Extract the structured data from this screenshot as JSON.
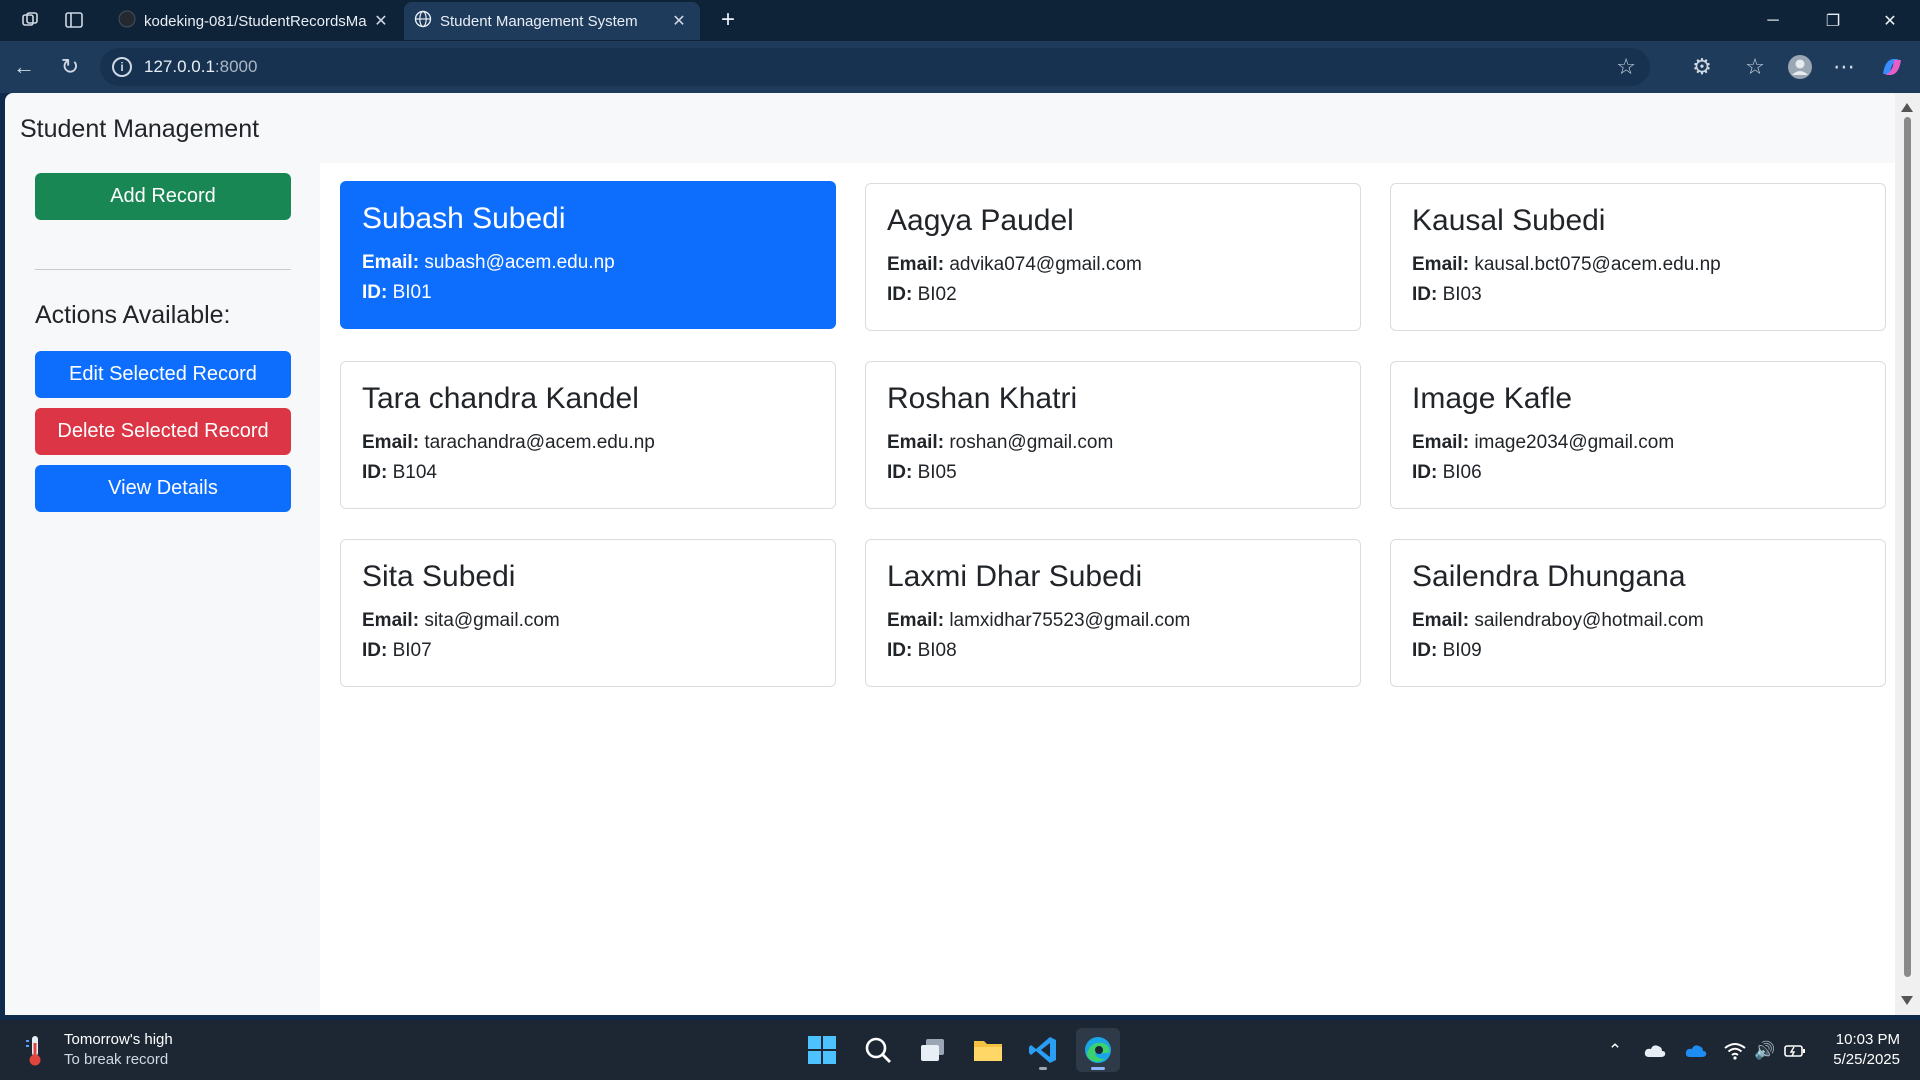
{
  "browser": {
    "tabs": [
      {
        "title": "kodeking-081/StudentRecordsMa",
        "active": false
      },
      {
        "title": "Student Management System",
        "active": true
      }
    ],
    "url_host": "127.0.0.1",
    "url_port": ":8000"
  },
  "page": {
    "brand": "Student Management",
    "sidebar": {
      "add_label": "Add Record",
      "actions_title": "Actions Available:",
      "edit_label": "Edit Selected Record",
      "delete_label": "Delete Selected Record",
      "view_label": "View Details"
    },
    "email_label": "Email:",
    "id_label": "ID:",
    "students": [
      {
        "name": "Subash Subedi",
        "email": "subash@acem.edu.np",
        "id": "BI01",
        "selected": true
      },
      {
        "name": "Aagya Paudel",
        "email": "advika074@gmail.com",
        "id": "BI02",
        "selected": false
      },
      {
        "name": "Kausal Subedi",
        "email": "kausal.bct075@acem.edu.np",
        "id": "BI03",
        "selected": false
      },
      {
        "name": "Tara chandra Kandel",
        "email": "tarachandra@acem.edu.np",
        "id": "B104",
        "selected": false
      },
      {
        "name": "Roshan Khatri",
        "email": "roshan@gmail.com",
        "id": "BI05",
        "selected": false
      },
      {
        "name": "Image Kafle",
        "email": "image2034@gmail.com",
        "id": "BI06",
        "selected": false
      },
      {
        "name": "Sita Subedi",
        "email": "sita@gmail.com",
        "id": "BI07",
        "selected": false
      },
      {
        "name": "Laxmi Dhar Subedi",
        "email": "lamxidhar75523@gmail.com",
        "id": "BI08",
        "selected": false
      },
      {
        "name": "Sailendra Dhungana",
        "email": "sailendraboy@hotmail.com",
        "id": "BI09",
        "selected": false
      }
    ]
  },
  "taskbar": {
    "weather_title": "Tomorrow's high",
    "weather_sub": "To break record",
    "time": "10:03 PM",
    "date": "5/25/2025"
  },
  "colors": {
    "primary": "#0d6efd",
    "success": "#198754",
    "danger": "#dc3545"
  }
}
